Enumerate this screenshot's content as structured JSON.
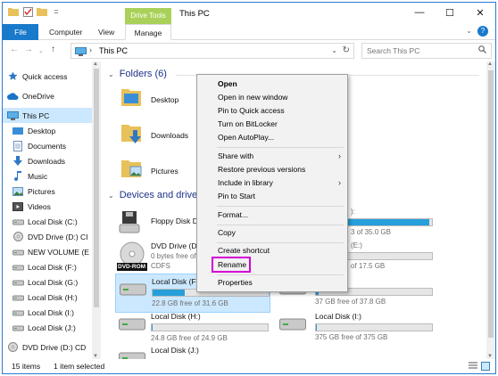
{
  "window": {
    "title": "This PC"
  },
  "ribbon": {
    "contextual_tab": "Drive Tools",
    "tabs": [
      "File",
      "Computer",
      "View",
      "Manage"
    ]
  },
  "address": {
    "crumb": "This PC",
    "search_placeholder": "Search This PC"
  },
  "navpane": {
    "items": [
      {
        "label": "Quick access",
        "icon": "star-icon"
      },
      {
        "label": "OneDrive",
        "icon": "cloud-icon"
      },
      {
        "label": "This PC",
        "icon": "computer-icon",
        "selected": true
      },
      {
        "label": "Desktop",
        "icon": "desktop-folder-icon"
      },
      {
        "label": "Documents",
        "icon": "documents-icon"
      },
      {
        "label": "Downloads",
        "icon": "downloads-icon"
      },
      {
        "label": "Music",
        "icon": "music-icon"
      },
      {
        "label": "Pictures",
        "icon": "pictures-icon"
      },
      {
        "label": "Videos",
        "icon": "videos-icon"
      },
      {
        "label": "Local Disk (C:)",
        "icon": "disk-icon"
      },
      {
        "label": "DVD Drive (D:) CI",
        "icon": "dvd-icon"
      },
      {
        "label": "NEW VOLUME (E",
        "icon": "disk-icon"
      },
      {
        "label": "Local Disk (F:)",
        "icon": "disk-icon"
      },
      {
        "label": "Local Disk (G:)",
        "icon": "disk-icon"
      },
      {
        "label": "Local Disk (H:)",
        "icon": "disk-icon"
      },
      {
        "label": "Local Disk (I:)",
        "icon": "disk-icon"
      },
      {
        "label": "Local Disk (J:)",
        "icon": "disk-icon"
      },
      {
        "label": "DVD Drive (D:) CD",
        "icon": "dvd-icon"
      }
    ]
  },
  "content": {
    "folders_header": "Folders (6)",
    "folders": [
      "Desktop",
      "Downloads",
      "Pictures"
    ],
    "devices_header": "Devices and drives",
    "drives": [
      {
        "name": "Floppy Disk Dri",
        "icon": "floppy-icon"
      },
      {
        "name": "DVD Drive (D:)",
        "info1": "0 bytes free of",
        "info2": "CDFS",
        "icon": "dvd-rom-icon",
        "badge": "DVD-ROM"
      },
      {
        "name": "Local Disk (F:)",
        "free": "22.8 GB free of 31.6 GB",
        "used_fraction": 0.28,
        "selected": true,
        "icon": "disk-icon"
      },
      {
        "name": "Local Disk (H:)",
        "free": "24.8 GB free of 24.9 GB",
        "used_fraction": 0.01,
        "icon": "disk-icon"
      },
      {
        "name": "Local Disk (J:)",
        "icon": "disk-icon"
      }
    ],
    "right_column": [
      {
        "name": "",
        "free": "3 of 35.0 GB",
        "used_fraction": 0.98
      },
      {
        "name": "(E:)",
        "free": "of 17.5 GB",
        "used_fraction": 0.02
      },
      {
        "name": "",
        "free": "37 GB free of 37.8 GB",
        "used_fraction": 0.02
      },
      {
        "name": "Local Disk (I:)",
        "free": "375 GB free of 375 GB",
        "used_fraction": 0.01
      }
    ],
    "right_peek": [
      "):",
      "3 GB"
    ]
  },
  "context_menu": {
    "items": [
      {
        "label": "Open",
        "bold": true
      },
      {
        "label": "Open in new window"
      },
      {
        "label": "Pin to Quick access"
      },
      {
        "label": "Turn on BitLocker"
      },
      {
        "label": "Open AutoPlay..."
      },
      {
        "label": "Share with",
        "submenu": true
      },
      {
        "label": "Restore previous versions"
      },
      {
        "label": "Include in library",
        "submenu": true
      },
      {
        "label": "Pin to Start"
      },
      {
        "label": "Format..."
      },
      {
        "label": "Copy"
      },
      {
        "label": "Create shortcut"
      },
      {
        "label": "Rename",
        "highlighted": true
      },
      {
        "label": "Properties"
      }
    ],
    "highlight_color": "#d400d4"
  },
  "status": {
    "items": "15 items",
    "selected": "1 item selected"
  }
}
